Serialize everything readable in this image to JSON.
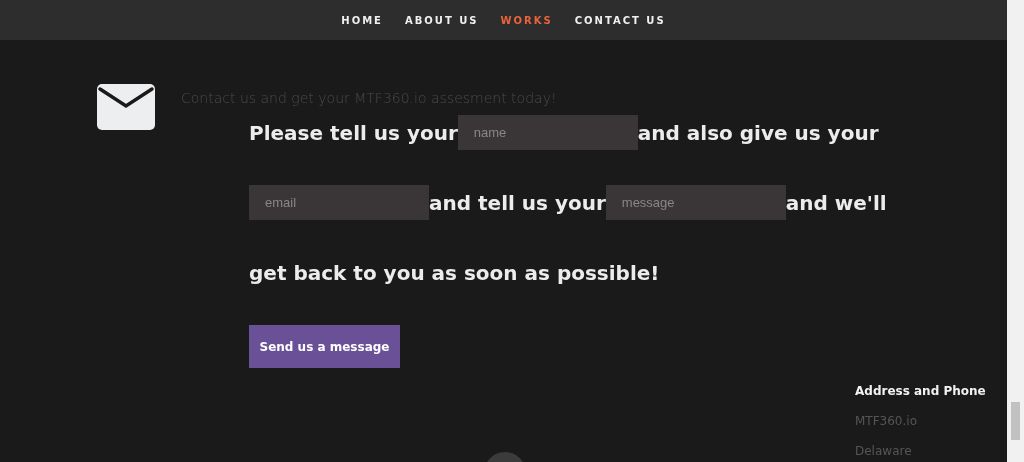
{
  "nav": [
    {
      "label": "HOME",
      "selected": false
    },
    {
      "label": "ABOUT US",
      "selected": false
    },
    {
      "label": "WORKS",
      "selected": true
    },
    {
      "label": "CONTACT US",
      "selected": false
    }
  ],
  "tagline": "Contact us and get your MTF360.io assesment today!",
  "form_lines": [
    [
      {
        "kind": "text",
        "text": "Please tell us your"
      },
      {
        "kind": "field",
        "placeholder": "name"
      },
      {
        "kind": "text",
        "text": "and also give us your"
      }
    ],
    [
      {
        "kind": "field",
        "placeholder": "email"
      },
      {
        "kind": "text",
        "text": "and tell us your"
      },
      {
        "kind": "field",
        "placeholder": "message"
      },
      {
        "kind": "text",
        "text": "and we'll"
      }
    ],
    [
      {
        "kind": "text",
        "text": "get back to you as soon as possible!"
      }
    ]
  ],
  "submit_button": "Send us a message",
  "footer": {
    "heading": "Address and Phone",
    "lines": [
      "MTF360.io",
      "Delaware"
    ]
  }
}
